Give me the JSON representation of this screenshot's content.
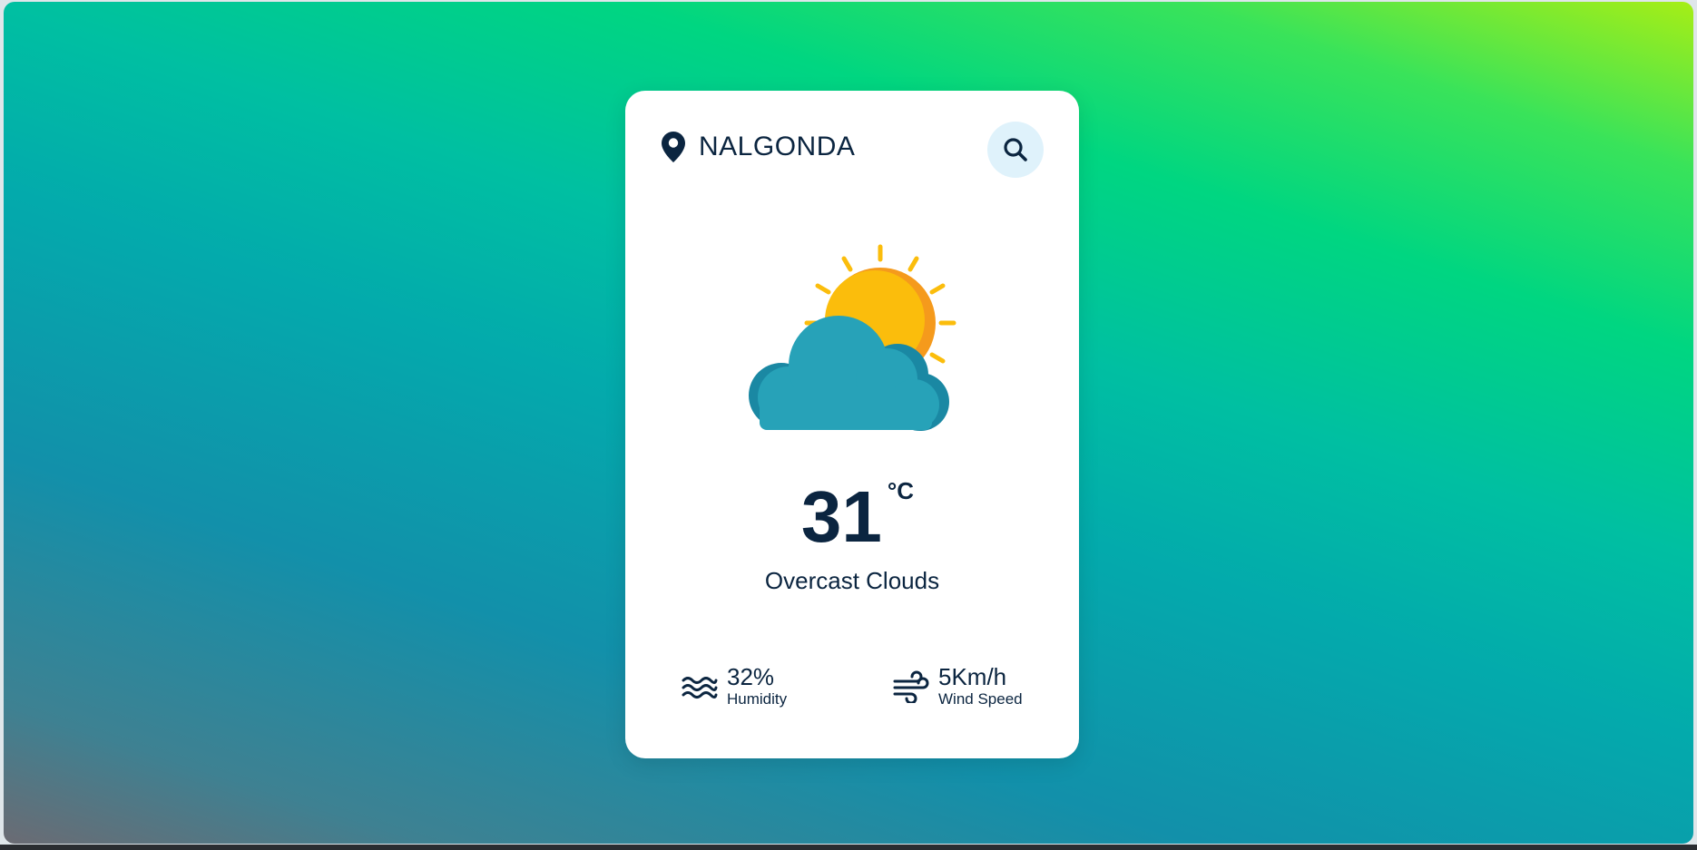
{
  "location": {
    "name": "NALGONDA",
    "icon": "map-pin-icon"
  },
  "search": {
    "icon": "search-icon"
  },
  "weather": {
    "icon": "partly-cloudy-icon",
    "temperature": "31",
    "unit": "°C",
    "condition": "Overcast Clouds"
  },
  "stats": {
    "humidity": {
      "value": "32%",
      "label": "Humidity",
      "icon": "waves-icon"
    },
    "wind": {
      "value": "5Km/h",
      "label": "Wind Speed",
      "icon": "wind-icon"
    }
  },
  "colors": {
    "text": "#0b2540",
    "card": "#ffffff",
    "search_button_bg": "#dff2fb",
    "sun": "#fbbd0c",
    "sun_shade": "#f59a1c",
    "cloud": "#27a2b8",
    "cloud_shade": "#1a88a3",
    "gradient_start": "#6b6b73",
    "gradient_mid": "#03aaac",
    "gradient_end": "#a6ee16"
  }
}
